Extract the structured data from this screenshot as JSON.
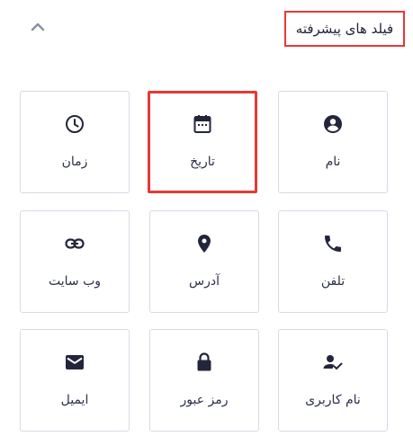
{
  "header": {
    "title": "فیلد های پیشرفته",
    "collapse_icon": "chevron-up-icon"
  },
  "colors": {
    "text": "#2b2f4a",
    "icon": "#23263b",
    "card_border": "#d8d9e6",
    "highlight": "#e53935",
    "chevron": "#8a8fa8"
  },
  "fields": [
    {
      "label": "نام",
      "icon": "account-circle-icon"
    },
    {
      "label": "تاریخ",
      "icon": "calendar-icon"
    },
    {
      "label": "زمان",
      "icon": "clock-icon"
    },
    {
      "label": "تلفن",
      "icon": "phone-icon"
    },
    {
      "label": "آدرس",
      "icon": "location-pin-icon"
    },
    {
      "label": "وب سایت",
      "icon": "link-icon"
    },
    {
      "label": "نام کاربری",
      "icon": "user-check-icon"
    },
    {
      "label": "رمز عبور",
      "icon": "lock-icon"
    },
    {
      "label": "ایمیل",
      "icon": "mail-icon"
    }
  ]
}
